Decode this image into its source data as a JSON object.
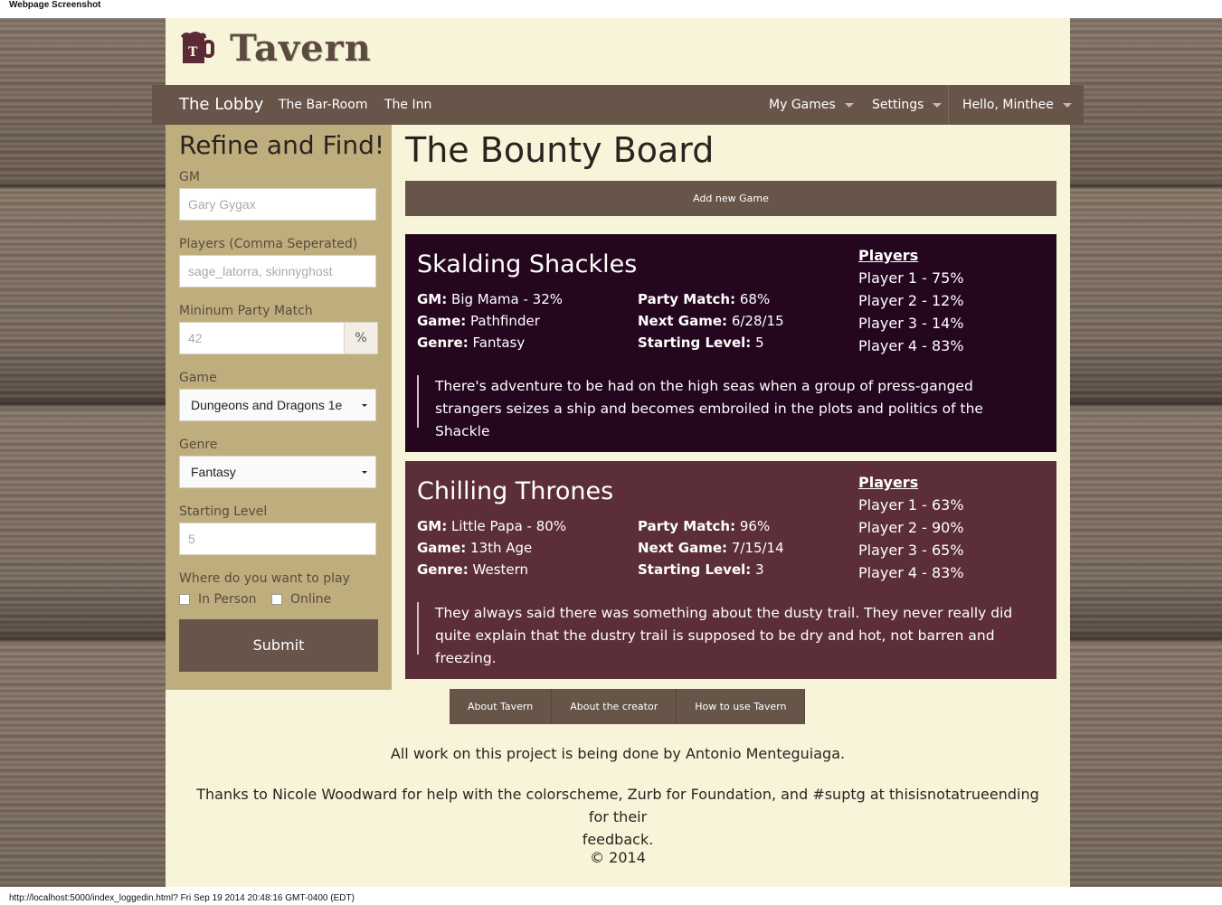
{
  "capture": {
    "header": "Webpage Screenshot",
    "footer": "http://localhost:5000/index_loggedin.html? Fri Sep 19 2014 20:48:16 GMT-0400 (EDT)"
  },
  "logo": {
    "text": "Tavern"
  },
  "nav": {
    "brand": "The Lobby",
    "links": [
      "The Bar-Room",
      "The Inn"
    ],
    "my_games": "My Games",
    "settings": "Settings",
    "user": "Hello, Minthee"
  },
  "sidebar": {
    "title": "Refine and Find!",
    "gm_label": "GM",
    "gm_placeholder": "Gary Gygax",
    "players_label": "Players (Comma Seperated)",
    "players_placeholder": "sage_latorra, skinnyghost",
    "match_label": "Mininum Party Match",
    "match_placeholder": "42",
    "match_suffix": "%",
    "game_label": "Game",
    "game_value": "Dungeons and Dragons 1e",
    "genre_label": "Genre",
    "genre_value": "Fantasy",
    "level_label": "Starting Level",
    "level_placeholder": "5",
    "where_label": "Where do you want to play",
    "in_person": "In Person",
    "online": "Online",
    "submit": "Submit"
  },
  "main": {
    "title": "The Bounty Board",
    "add_game": "Add new Game",
    "labels": {
      "gm": "GM:",
      "game": "Game:",
      "genre": "Genre:",
      "party_match": "Party Match:",
      "next_game": "Next Game:",
      "starting_level": "Starting Level:",
      "players": "Players"
    },
    "games": [
      {
        "name": "Skalding Shackles",
        "color": "#24061f",
        "gm": "Big Mama - 32%",
        "game": "Pathfinder",
        "genre": "Fantasy",
        "party_match": "68%",
        "next_game": "6/28/15",
        "starting_level": "5",
        "players": [
          "Player 1 - 75%",
          "Player 2 - 12%",
          "Player 3 - 14%",
          "Player 4 - 83%"
        ],
        "description": "There's adventure to be had on the high seas when a group of press-ganged strangers seizes a ship and becomes embroiled in the plots and politics of the Shackle"
      },
      {
        "name": "Chilling Thrones",
        "color": "#5c2e3a",
        "gm": "Little Papa - 80%",
        "game": "13th Age",
        "genre": "Western",
        "party_match": "96%",
        "next_game": "7/15/14",
        "starting_level": "3",
        "players": [
          "Player 1 - 63%",
          "Player 2 - 90%",
          "Player 3 - 65%",
          "Player 4 - 83%"
        ],
        "description": "They always said there was something about the dusty trail. They never really did quite explain that the dustry trail is supposed to be dry and hot, not barren and freezing."
      }
    ]
  },
  "footer": {
    "links": [
      "About Tavern",
      "About the creator",
      "How to use Tavern"
    ],
    "credit1": "All work on this project is being done by Antonio Menteguiaga.",
    "credit2a": "Thanks to Nicole Woodward for help with the colorscheme, Zurb for Foundation, and #suptg at thisisnotatrueending for their",
    "credit2b": "feedback.",
    "copyright": "© 2014"
  }
}
